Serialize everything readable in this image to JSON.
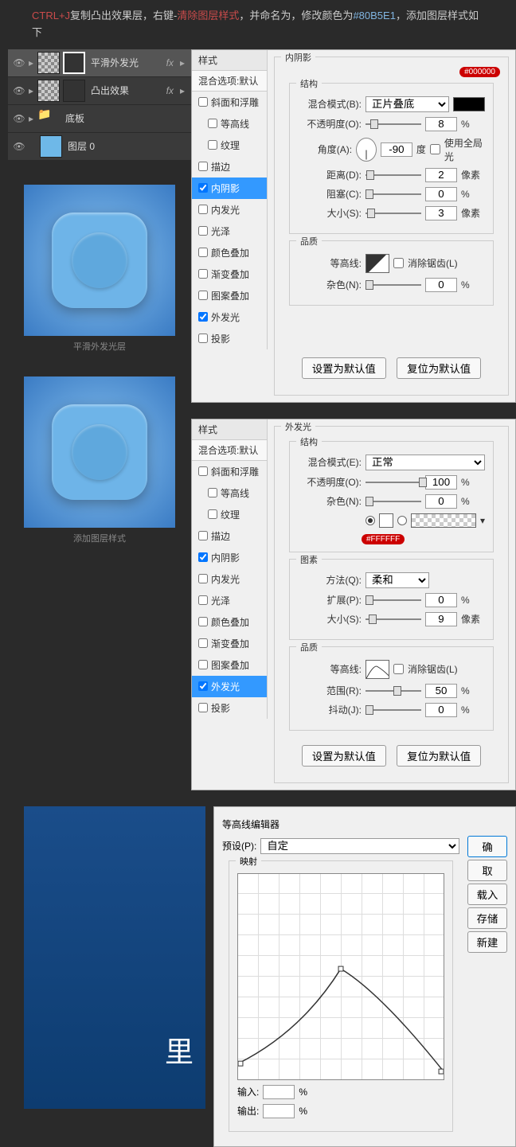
{
  "header": {
    "ctrl": "CTRL+J",
    "t1": "复制凸出效果层，右键-",
    "clear": "清除图层样式",
    "t2": "，并命名为",
    "hidden": "",
    "t3": "，修改颜色为",
    "color": "#80B5E1",
    "t4": "，添加图层样式如下"
  },
  "layers": [
    {
      "name": "平滑外发光",
      "fx": "fx",
      "thumb": "checker"
    },
    {
      "name": "凸出效果",
      "fx": "fx",
      "thumb": "checker"
    },
    {
      "name": "底板",
      "folder": true
    },
    {
      "name": "图层 0",
      "thumb": "solid-blue"
    }
  ],
  "previews": [
    {
      "label": "平滑外发光层"
    },
    {
      "label": "添加图层样式"
    }
  ],
  "styles_title": "样式",
  "blend_default": "混合选项:默认",
  "style_items": [
    "斜面和浮雕",
    "等高线",
    "纹理",
    "描边",
    "内阴影",
    "内发光",
    "光泽",
    "颜色叠加",
    "渐变叠加",
    "图案叠加",
    "外发光",
    "投影"
  ],
  "dialog1": {
    "title": "内阴影",
    "struct": "结构",
    "badge": "#000000",
    "blend_mode_label": "混合模式(B):",
    "blend_mode": "正片叠底",
    "opacity_label": "不透明度(O):",
    "opacity": "8",
    "angle_label": "角度(A):",
    "angle": "-90",
    "angle_unit": "度",
    "global": "使用全局光",
    "distance_label": "距离(D):",
    "distance": "2",
    "px": "像素",
    "choke_label": "阻塞(C):",
    "choke": "0",
    "size_label": "大小(S):",
    "size": "3",
    "quality": "品质",
    "contour_label": "等高线:",
    "antialias": "消除锯齿(L)",
    "noise_label": "杂色(N):",
    "noise": "0",
    "pct": "%",
    "btn_default": "设置为默认值",
    "btn_reset": "复位为默认值"
  },
  "dialog2": {
    "title": "外发光",
    "struct": "结构",
    "blend_mode_label": "混合模式(E):",
    "blend_mode": "正常",
    "opacity_label": "不透明度(O):",
    "opacity": "100",
    "noise_label": "杂色(N):",
    "noise": "0",
    "badge": "#FFFFFF",
    "elements": "图素",
    "method_label": "方法(Q):",
    "method": "柔和",
    "spread_label": "扩展(P):",
    "spread": "0",
    "size_label": "大小(S):",
    "size": "9",
    "px": "像素",
    "quality": "品质",
    "contour_label": "等高线:",
    "antialias": "消除锯齿(L)",
    "range_label": "范围(R):",
    "range": "50",
    "jitter_label": "抖动(J):",
    "jitter": "0",
    "pct": "%",
    "btn_default": "设置为默认值",
    "btn_reset": "复位为默认值"
  },
  "contour_editor": {
    "title": "等高线编辑器",
    "preset_label": "预设(P):",
    "preset": "自定",
    "mapping": "映射",
    "input_label": "输入:",
    "output_label": "输出:",
    "pct": "%",
    "btn_ok": "确",
    "btn_cancel": "取",
    "btn_load": "载入",
    "btn_save": "存储",
    "btn_new": "新建"
  },
  "overlay_text": "里"
}
